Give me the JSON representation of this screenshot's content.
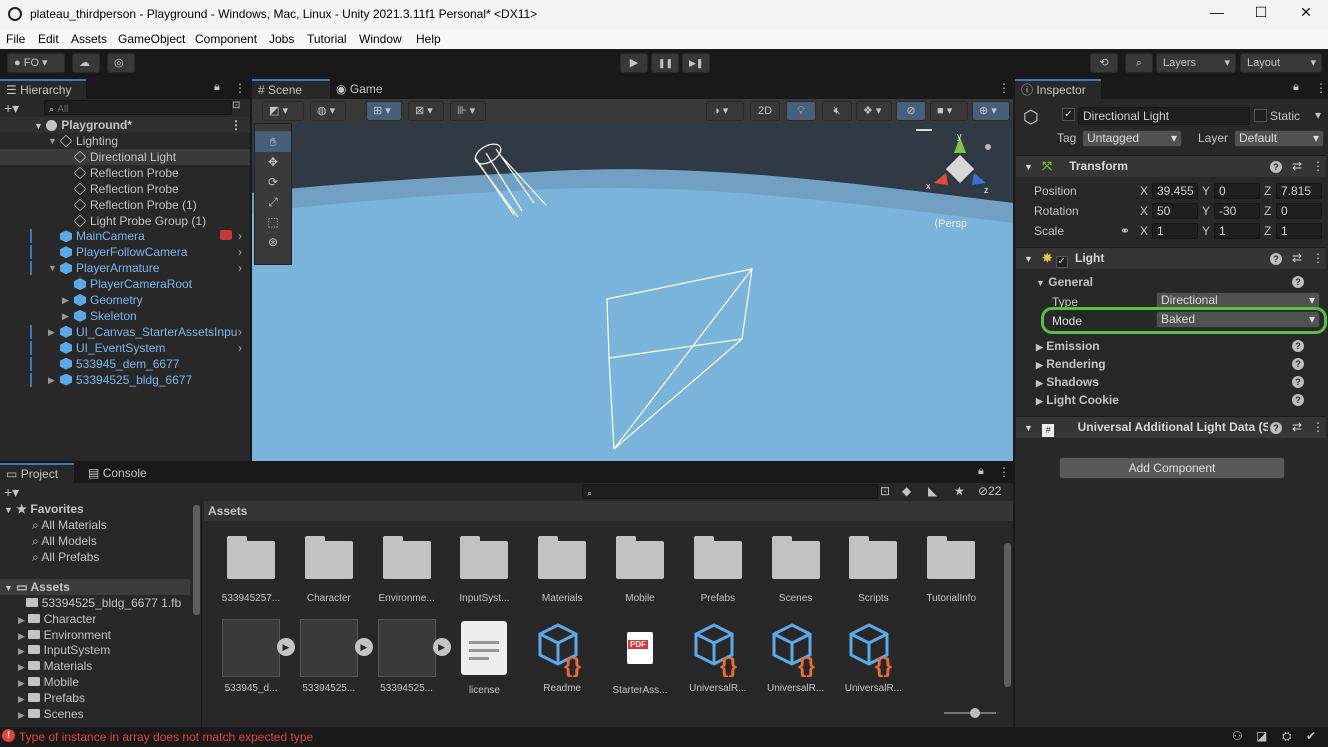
{
  "window": {
    "title": "plateau_thirdperson - Playground - Windows, Mac, Linux - Unity 2021.3.11f1 Personal* <DX11>",
    "minimize": "—",
    "maximize": "☐",
    "close": "✕"
  },
  "menu": [
    "File",
    "Edit",
    "Assets",
    "GameObject",
    "Component",
    "Jobs",
    "Tutorial",
    "Window",
    "Help"
  ],
  "toolbar": {
    "account": "FO",
    "layers": "Layers",
    "layout": "Layout",
    "play": "▶",
    "pause": "❚❚",
    "step": "▶❚"
  },
  "hierarchy": {
    "tab": "Hierarchy",
    "search_placeholder": "All",
    "scene": "Playground*",
    "items": [
      {
        "label": "Lighting",
        "indent": 1,
        "blue": false
      },
      {
        "label": "Directional Light",
        "indent": 2,
        "blue": false
      },
      {
        "label": "Reflection Probe",
        "indent": 2,
        "blue": false
      },
      {
        "label": "Reflection Probe",
        "indent": 2,
        "blue": false
      },
      {
        "label": "Reflection Probe (1)",
        "indent": 2,
        "blue": false
      },
      {
        "label": "Light Probe Group (1)",
        "indent": 2,
        "blue": false
      },
      {
        "label": "MainCamera",
        "indent": 1,
        "blue": true
      },
      {
        "label": "PlayerFollowCamera",
        "indent": 1,
        "blue": true
      },
      {
        "label": "PlayerArmature",
        "indent": 1,
        "blue": true
      },
      {
        "label": "PlayerCameraRoot",
        "indent": 2,
        "blue": true
      },
      {
        "label": "Geometry",
        "indent": 2,
        "blue": true
      },
      {
        "label": "Skeleton",
        "indent": 2,
        "blue": true
      },
      {
        "label": "UI_Canvas_StarterAssetsInpu",
        "indent": 1,
        "blue": true
      },
      {
        "label": "UI_EventSystem",
        "indent": 1,
        "blue": true
      },
      {
        "label": "533945_dem_6677",
        "indent": 1,
        "blue": true
      },
      {
        "label": "53394525_bldg_6677",
        "indent": 1,
        "blue": true
      }
    ]
  },
  "scene": {
    "tab_scene": "Scene",
    "tab_game": "Game",
    "mode_2d": "2D",
    "persp": "Persp",
    "gizmo_y": "y",
    "gizmo_x": "x",
    "gizmo_z": "z"
  },
  "inspector": {
    "tab": "Inspector",
    "object_name": "Directional Light",
    "static_label": "Static",
    "tag_label": "Tag",
    "tag_value": "Untagged",
    "layer_label": "Layer",
    "layer_value": "Default",
    "transform": {
      "title": "Transform",
      "position_label": "Position",
      "position": [
        "39.455",
        "0",
        "7.815"
      ],
      "rotation_label": "Rotation",
      "rotation": [
        "50",
        "-30",
        "0"
      ],
      "scale_label": "Scale",
      "scale": [
        "1",
        "1",
        "1"
      ],
      "axis": [
        "X",
        "Y",
        "Z"
      ]
    },
    "light": {
      "title": "Light",
      "general": "General",
      "type_label": "Type",
      "type_value": "Directional",
      "mode_label": "Mode",
      "mode_value": "Baked",
      "emission": "Emission",
      "rendering": "Rendering",
      "shadows": "Shadows",
      "cookie": "Light Cookie"
    },
    "urp_component": "Universal Additional Light Data (S",
    "add_component": "Add Component"
  },
  "project": {
    "tab_project": "Project",
    "tab_console": "Console",
    "hidden_count": "22",
    "favorites_label": "Favorites",
    "favorites": [
      "All Materials",
      "All Models",
      "All Prefabs"
    ],
    "assets_label": "Assets",
    "tree": [
      "53394525_bldg_6677 1.fb",
      "Character",
      "Environment",
      "InputSystem",
      "Materials",
      "Mobile",
      "Prefabs",
      "Scenes"
    ],
    "breadcrumb": "Assets",
    "folders": [
      "533945257...",
      "Character",
      "Environme...",
      "InputSyst...",
      "Materials",
      "Mobile",
      "Prefabs",
      "Scenes",
      "Scripts",
      "TutorialInfo"
    ],
    "files": [
      {
        "label": "533945_d...",
        "kind": "thumb"
      },
      {
        "label": "53394525...",
        "kind": "thumb"
      },
      {
        "label": "53394525...",
        "kind": "thumb"
      },
      {
        "label": "license",
        "kind": "doc"
      },
      {
        "label": "Readme",
        "kind": "script"
      },
      {
        "label": "StarterAss...",
        "kind": "pdf"
      },
      {
        "label": "UniversalR...",
        "kind": "script"
      },
      {
        "label": "UniversalR...",
        "kind": "script"
      },
      {
        "label": "UniversalR...",
        "kind": "script"
      }
    ],
    "pdf_text": "PDF"
  },
  "status": {
    "message": "Type of instance in array does not match expected type",
    "color": "#e0453a"
  },
  "colors": {
    "highlight": "#56c143",
    "accent": "#3a79bb",
    "prefab": "#7bb6ec",
    "sky": "#79b0d6"
  }
}
